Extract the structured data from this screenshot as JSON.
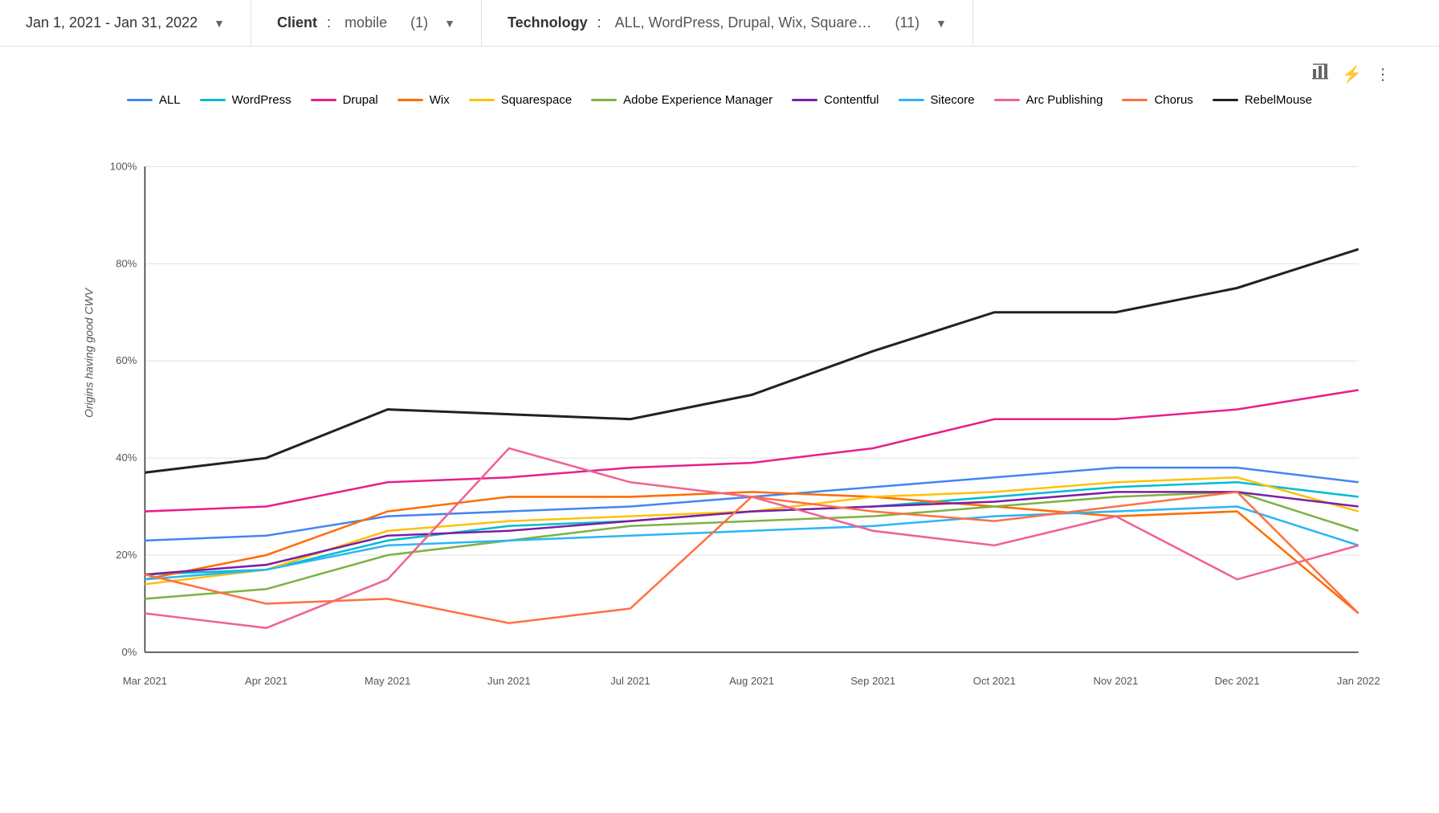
{
  "header": {
    "date_range": {
      "label": "Jan 1, 2021 - Jan 31, 2022",
      "chevron": "▼"
    },
    "client": {
      "label": "Client",
      "value": "mobile",
      "count": "(1)",
      "chevron": "▼"
    },
    "technology": {
      "label": "Technology",
      "value": "ALL, WordPress, Drupal, Wix, Square…",
      "count": "(11)",
      "chevron": "▼"
    }
  },
  "toolbar": {
    "chart_icon": "⊞",
    "lightning_icon": "⚡",
    "more_icon": "⋮"
  },
  "legend": [
    {
      "name": "ALL",
      "color": "#4285F4"
    },
    {
      "name": "WordPress",
      "color": "#00BCD4"
    },
    {
      "name": "Drupal",
      "color": "#E91E8C"
    },
    {
      "name": "Wix",
      "color": "#FF6D00"
    },
    {
      "name": "Squarespace",
      "color": "#FFC107"
    },
    {
      "name": "Adobe Experience Manager",
      "color": "#7CB342"
    },
    {
      "name": "Contentful",
      "color": "#7B1FA2"
    },
    {
      "name": "Sitecore",
      "color": "#29B6F6"
    },
    {
      "name": "Arc Publishing",
      "color": "#F06292"
    },
    {
      "name": "Chorus",
      "color": "#FF7043"
    },
    {
      "name": "RebelMouse",
      "color": "#212121"
    }
  ],
  "y_axis": {
    "labels": [
      "0%",
      "20%",
      "40%",
      "60%",
      "80%",
      "100%"
    ],
    "title": "Origins having good CWV"
  },
  "x_axis": {
    "labels": [
      "Mar 2021",
      "Apr 2021",
      "May 2021",
      "Jun 2021",
      "Jul 2021",
      "Aug 2021",
      "Sep 2021",
      "Oct 2021",
      "Nov 2021",
      "Dec 2021",
      "Jan 2022"
    ]
  }
}
